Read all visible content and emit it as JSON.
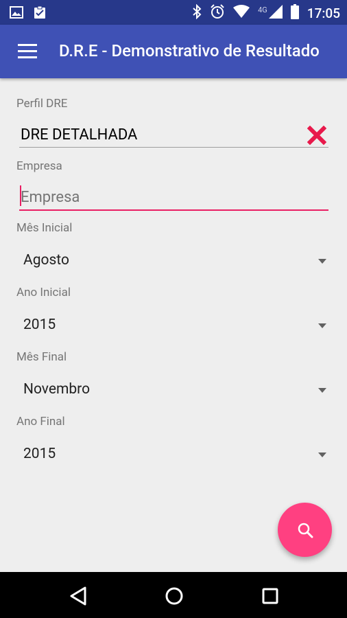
{
  "status_bar": {
    "time": "17:05",
    "network": "4G",
    "icons": [
      "image-icon",
      "clipboard-icon",
      "bluetooth-icon",
      "alarm-icon",
      "wifi-icon",
      "signal-icon",
      "battery-icon"
    ]
  },
  "app_bar": {
    "title": "D.R.E - Demonstrativo de Resultado",
    "menu_icon": "menu-icon"
  },
  "form": {
    "perfil": {
      "label": "Perfil DRE",
      "value": "DRE DETALHADA",
      "clear_icon": "close-icon"
    },
    "empresa": {
      "label": "Empresa",
      "placeholder": "Empresa",
      "value": ""
    },
    "mes_inicial": {
      "label": "Mês Inicial",
      "value": "Agosto"
    },
    "ano_inicial": {
      "label": "Ano Inicial",
      "value": "2015"
    },
    "mes_final": {
      "label": "Mês Final",
      "value": "Novembro"
    },
    "ano_final": {
      "label": "Ano Final",
      "value": "2015"
    }
  },
  "fab": {
    "icon": "search-icon"
  },
  "nav_bar": {
    "back_icon": "back-icon",
    "home_icon": "home-icon",
    "recents_icon": "recents-icon"
  },
  "colors": {
    "status_bar": "#27388a",
    "app_bar": "#3f51b5",
    "accent": "#e91e63",
    "fab": "#ff4081",
    "clear": "#e8194b",
    "background": "#eeeeee"
  }
}
